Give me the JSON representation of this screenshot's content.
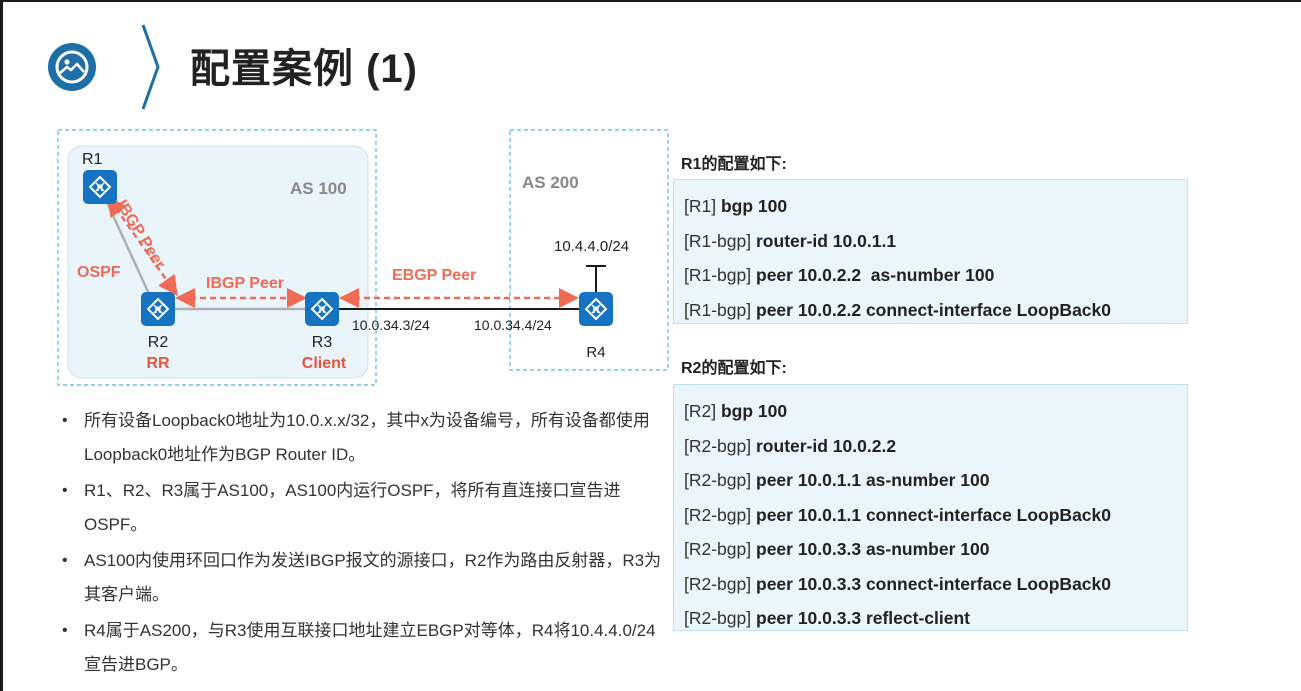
{
  "title": "配置案例 (1)",
  "diagram": {
    "as100_label": "AS 100",
    "as200_label": "AS 200",
    "r1": "R1",
    "r2": "R2",
    "r2_role": "RR",
    "r3": "R3",
    "r3_role": "Client",
    "r4": "R4",
    "ospf_label": "OSPF",
    "ibgp_peer_r1r2": "IBGP Peer",
    "ibgp_peer_r2r3": "IBGP Peer",
    "ebgp_peer": "EBGP Peer",
    "r3_ip": "10.0.34.3/24",
    "r4_ip": "10.0.34.4/24",
    "r4_network": "10.4.4.0/24",
    "accent_color": "#f06b55",
    "role_color": "#e8533b"
  },
  "bullets": [
    "所有设备Loopback0地址为10.0.x.x/32，其中x为设备编号，所有设备都使用Loopback0地址作为BGP Router ID。",
    "R1、R2、R3属于AS100，AS100内运行OSPF，将所有直连接口宣告进OSPF。",
    "AS100内使用环回口作为发送IBGP报文的源接口，R2作为路由反射器，R3为其客户端。",
    "R4属于AS200，与R3使用互联接口地址建立EBGP对等体，R4将10.4.4.0/24宣告进BGP。"
  ],
  "r1_config": {
    "heading": "R1的配置如下:",
    "lines": [
      {
        "prompt": "[R1]",
        "cmd": "bgp 100"
      },
      {
        "prompt": "[R1-bgp]",
        "cmd": "router-id 10.0.1.1"
      },
      {
        "prompt": "[R1-bgp]",
        "cmd": "peer 10.0.2.2  as-number 100"
      },
      {
        "prompt": "[R1-bgp]",
        "cmd": "peer 10.0.2.2 connect-interface LoopBack0"
      }
    ]
  },
  "r2_config": {
    "heading": "R2的配置如下:",
    "lines": [
      {
        "prompt": "[R2]",
        "cmd": "bgp 100"
      },
      {
        "prompt": "[R2-bgp]",
        "cmd": "router-id 10.0.2.2"
      },
      {
        "prompt": "[R2-bgp]",
        "cmd": "peer 10.0.1.1 as-number 100"
      },
      {
        "prompt": "[R2-bgp]",
        "cmd": "peer 10.0.1.1 connect-interface LoopBack0"
      },
      {
        "prompt": "[R2-bgp]",
        "cmd": "peer 10.0.3.3 as-number 100"
      },
      {
        "prompt": "[R2-bgp]",
        "cmd": "peer 10.0.3.3 connect-interface LoopBack0"
      },
      {
        "prompt": "[R2-bgp]",
        "cmd": "peer 10.0.3.3 reflect-client"
      }
    ]
  }
}
